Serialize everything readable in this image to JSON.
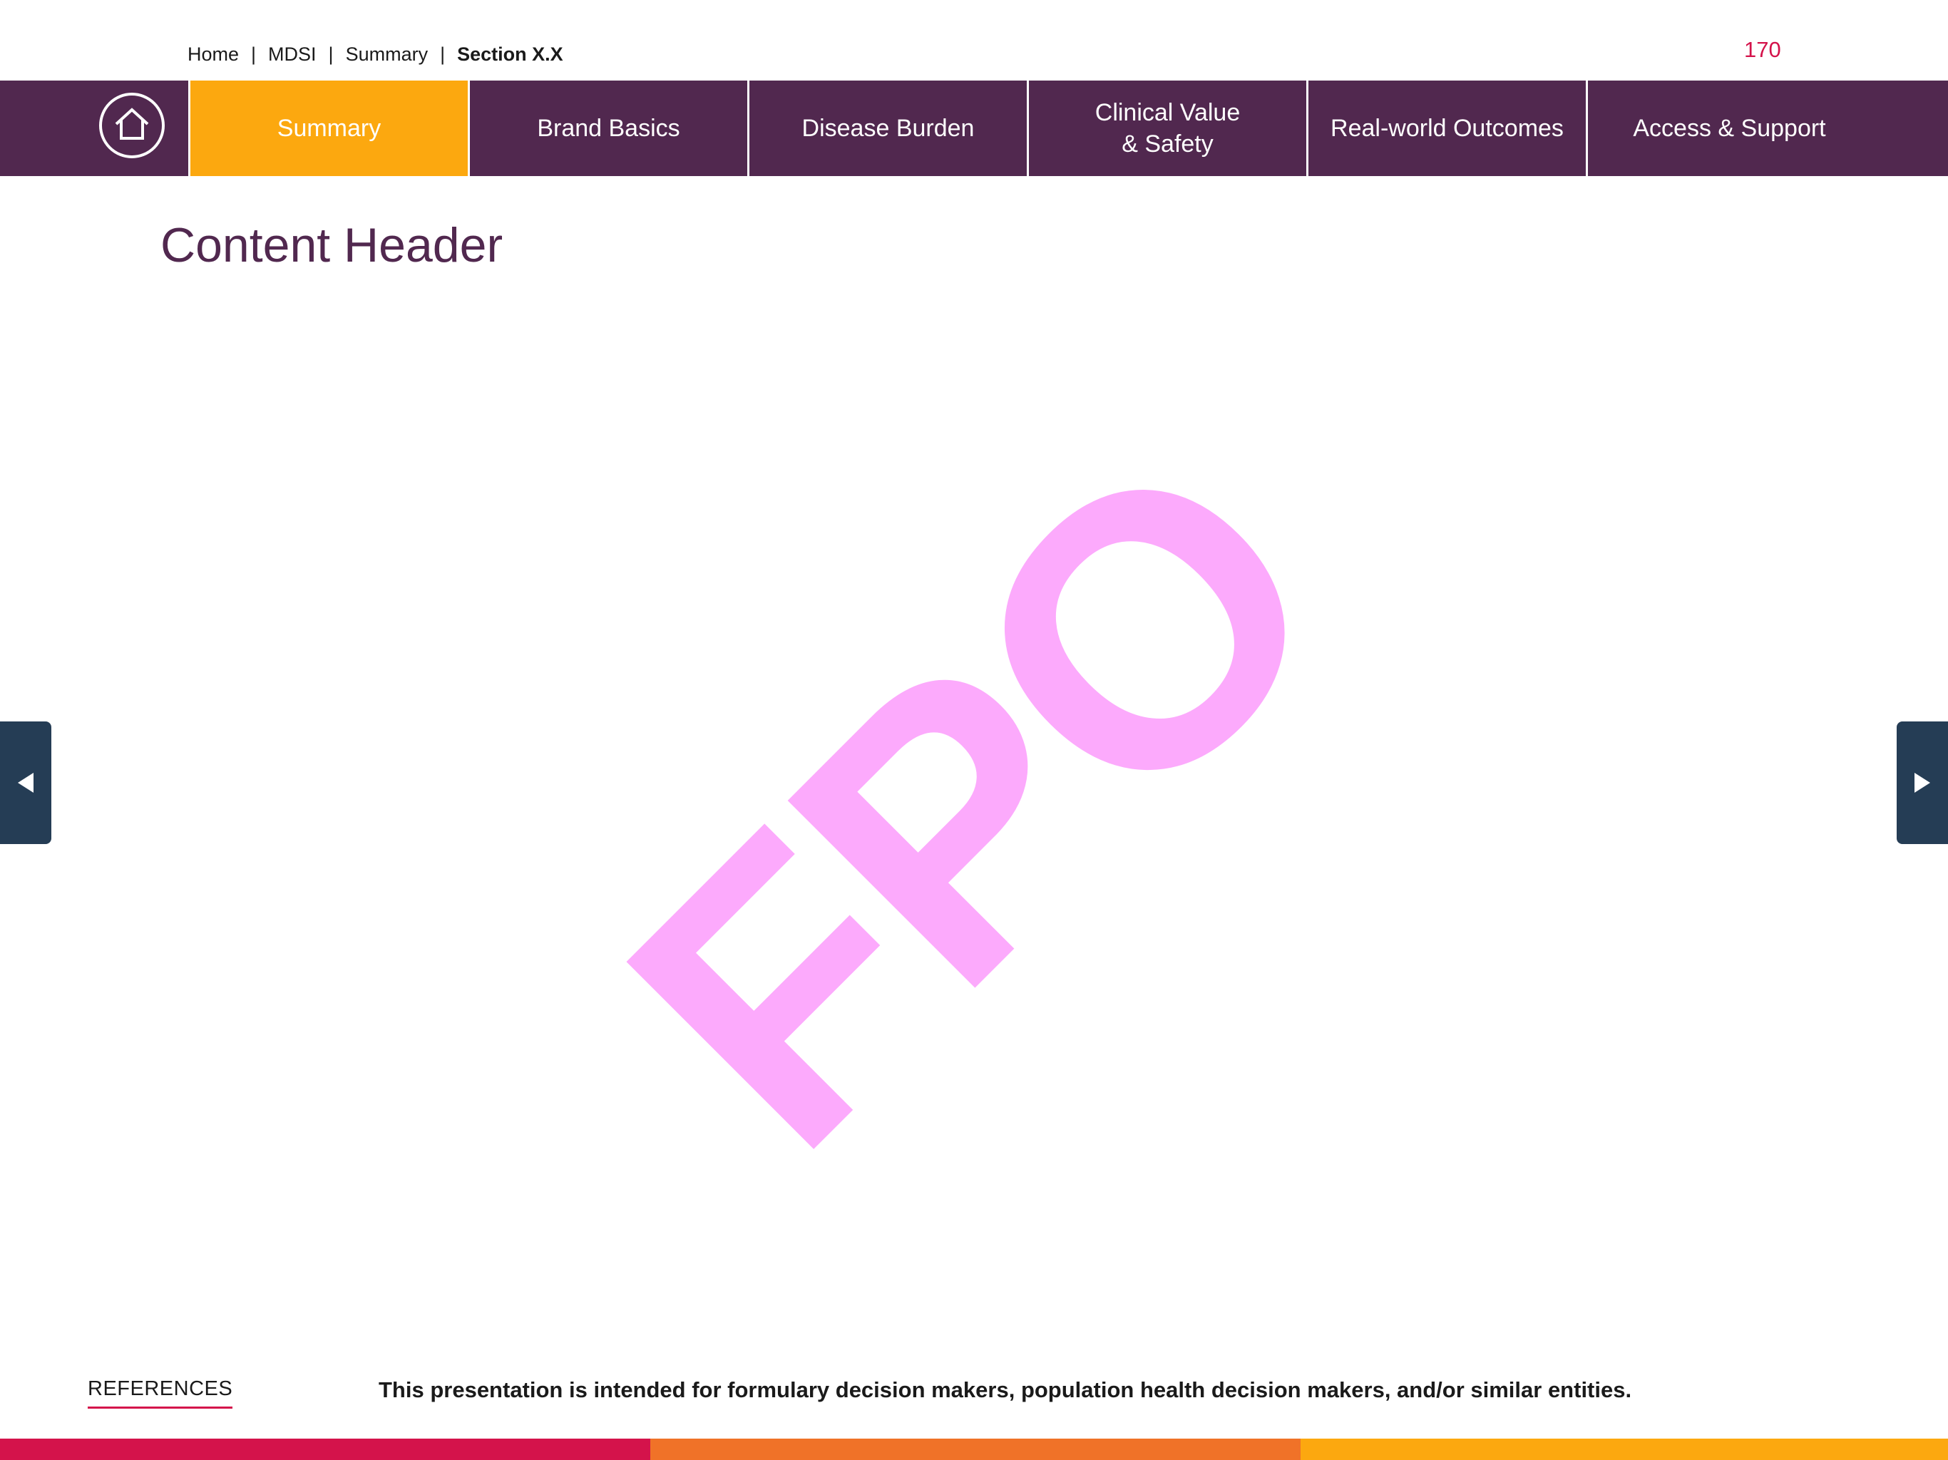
{
  "breadcrumb": {
    "items": [
      "Home",
      "MDSI",
      "Summary"
    ],
    "current": "Section X.X",
    "separator": "|"
  },
  "page_number": "170",
  "nav": {
    "home_icon": "home-icon",
    "tabs": [
      {
        "label": "Summary",
        "active": true
      },
      {
        "label": "Brand Basics",
        "active": false
      },
      {
        "label": "Disease Burden",
        "active": false
      },
      {
        "label": "Clinical Value\n& Safety",
        "active": false
      },
      {
        "label": "Real-world Outcomes",
        "active": false
      },
      {
        "label": "Access & Support",
        "active": false
      }
    ]
  },
  "content": {
    "header": "Content Header",
    "placeholder": "FPO"
  },
  "arrows": {
    "prev_icon": "caret-left-icon",
    "next_icon": "caret-right-icon"
  },
  "footer": {
    "references_label": "REFERENCES",
    "disclaimer": "This presentation is intended for formulary decision makers, population health decision makers, and/or similar entities."
  },
  "colors": {
    "nav_bg": "#51284f",
    "active_tab": "#fca80f",
    "accent_red": "#d4134b",
    "arrow_bg": "#253d55",
    "fpo": "#fcaafc",
    "bar_segments": [
      "#d4134b",
      "#f07228",
      "#fca80f"
    ]
  }
}
